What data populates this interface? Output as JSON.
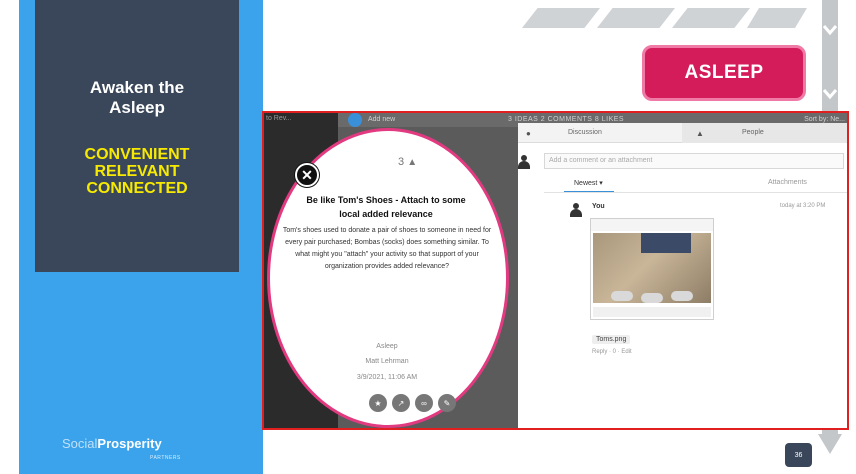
{
  "slide": {
    "title_line1": "Awaken the",
    "title_line2": "Asleep",
    "keywords": [
      "CONVENIENT",
      "RELEVANT",
      "CONNECTED"
    ],
    "badge": "ASLEEP",
    "page_number": "36",
    "brand": {
      "part1": "Social",
      "part2": "Prosperity",
      "sub": "PARTNERS"
    }
  },
  "app": {
    "left_row": "to Rev...",
    "add_new": "Add new",
    "stats": "3 IDEAS  2 COMMENTS  8 LIKES",
    "sort_by": "Sort by: Ne...",
    "tabs": {
      "discussion": "Discussion",
      "people": "People"
    },
    "comment_placeholder": "Add a comment or an attachment",
    "filter": "Newest ▾",
    "attachments": "Attachments",
    "comment_author": "You",
    "comment_time": "today at 3:20 PM",
    "attachment_name": "Toms.png",
    "reply_line": "Reply · 0 · Edit"
  },
  "idea": {
    "votes": "3",
    "title": "Be like Tom's Shoes - Attach to some local added relevance",
    "body": "Tom's shoes used to donate a pair of shoes to someone in need for every pair purchased; Bombas (socks) does something similar. To what might you \"attach\" your activity so that support of your organization provides added relevance?",
    "category": "Asleep",
    "author": "Matt Lehrman",
    "date": "3/9/2021, 11:06 AM"
  },
  "colors": {
    "left_band": "#3aa3ec",
    "dark_box": "#3a475a",
    "keyword": "#f7ea00",
    "badge": "#d51c5a",
    "circle_border": "#e23a80",
    "shot_border": "#e02020"
  }
}
